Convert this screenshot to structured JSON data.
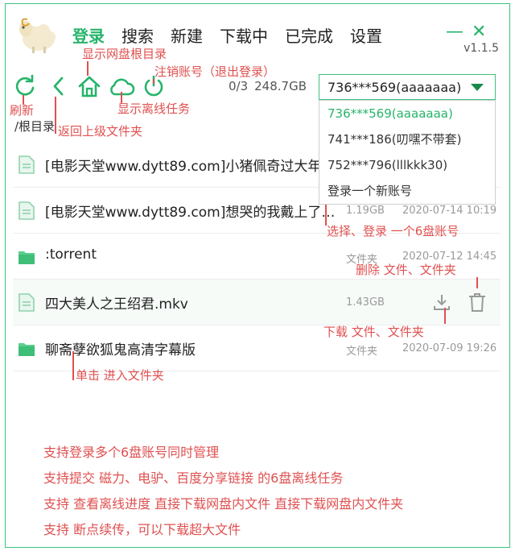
{
  "nav": [
    "登录",
    "搜索",
    "新建",
    "下载中",
    "已完成",
    "设置"
  ],
  "window": {
    "minimize": "—",
    "close": "✕",
    "version": "v1.1.5"
  },
  "toolbar": {
    "count": "0/3",
    "size": "248.7GB",
    "path": "/根目录"
  },
  "account": {
    "selected": "736***569(aaaaaaa)",
    "options": [
      "736***569(aaaaaaa)",
      "741***186(叨嘿不带套)",
      "752***796(lllkkk30)",
      "登录一个新账号"
    ]
  },
  "files": [
    {
      "name": "[电影天堂www.dytt89.com]小猪佩奇过大年",
      "size": "",
      "date": ""
    },
    {
      "name": "[电影天堂www.dytt89.com]想哭的我戴上了…",
      "size": "1.19GB",
      "date": "2020-07-14 10:19"
    },
    {
      "name": ":torrent",
      "size": "文件夹",
      "date": "2020-07-12 14:45"
    },
    {
      "name": "四大美人之王绍君.mkv",
      "size": "1.43GB",
      "date": ""
    },
    {
      "name": "聊斋孽欲狐鬼高清字幕版",
      "size": "文件夹",
      "date": "2020-07-09 19:26"
    }
  ],
  "annotations": {
    "root": "显示网盘根目录",
    "logout": "注销账号（退出登录）",
    "refresh": "刷新",
    "offline": "显示离线任务",
    "back": "返回上级文件夹",
    "select": "选择、登录  一个6盘账号",
    "delete": "删除 文件、文件夹",
    "download": "下载 文件、文件夹",
    "enter": "单击 进入文件夹"
  },
  "features": [
    "支持登录多个6盘账号同时管理",
    "支持提交    磁力、电驴、百度分享链接    的6盘离线任务",
    "支持    查看离线进度    直接下载网盘内文件    直接下载网盘内文件夹",
    "支持    断点续传，可以下载超大文件"
  ],
  "colors": {
    "accent": "#26b46a",
    "annotation": "#e05050",
    "border": "#3cc27c"
  },
  "icons": [
    "sheep-logo",
    "refresh-icon",
    "back-icon",
    "home-icon",
    "cloud-icon",
    "power-icon",
    "file-icon",
    "folder-icon",
    "download-icon",
    "trash-icon"
  ]
}
